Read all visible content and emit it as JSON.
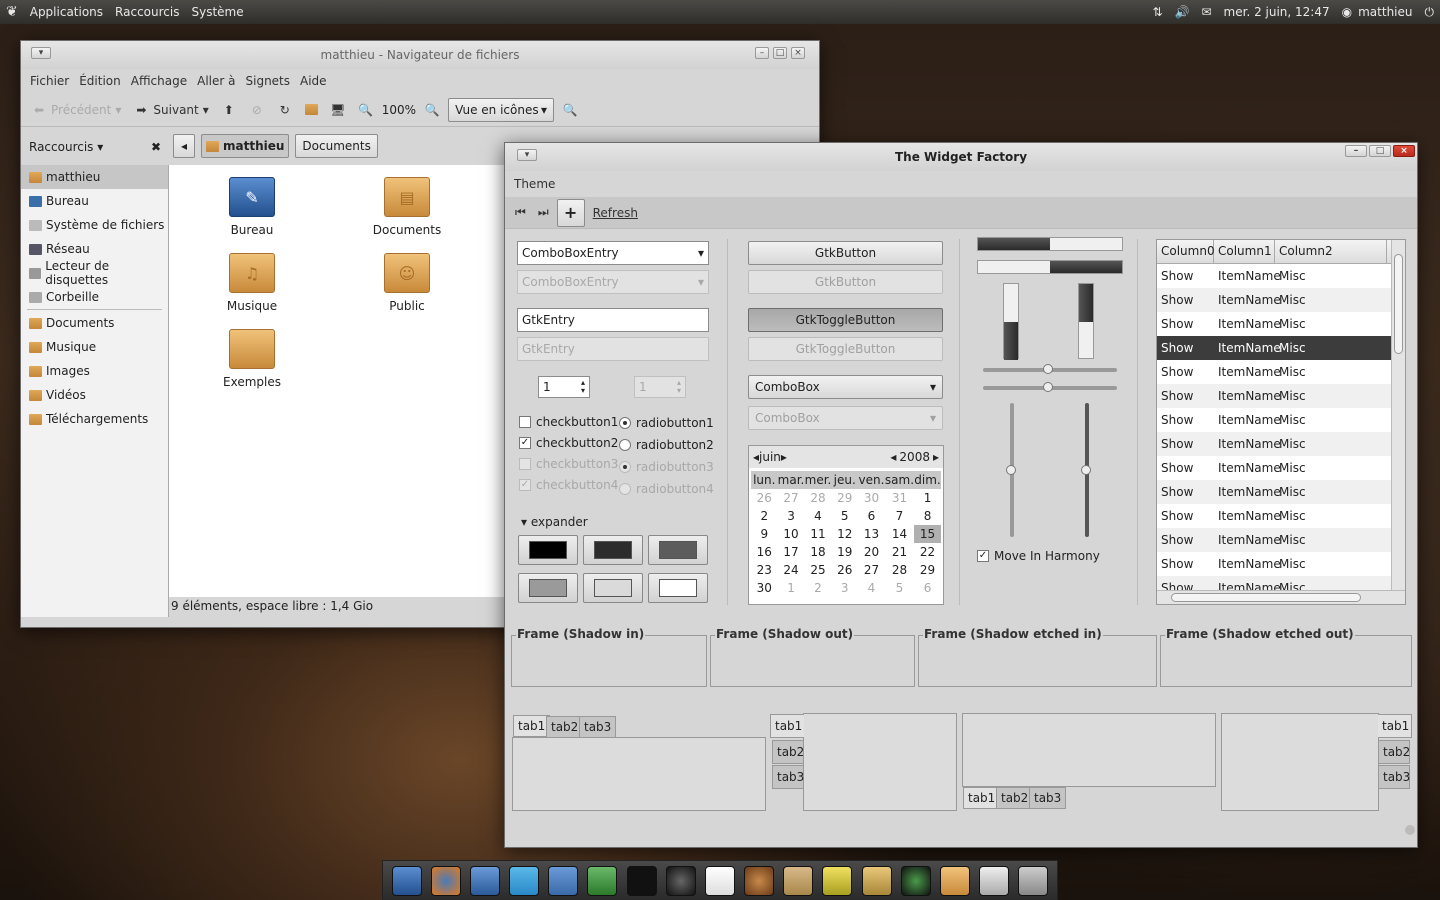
{
  "panel": {
    "menu": [
      "Applications",
      "Raccourcis",
      "Système"
    ],
    "datetime": "mer. 2 juin, 12:47",
    "user": "matthieu"
  },
  "filemanager": {
    "title": "matthieu - Navigateur de fichiers",
    "menu": [
      "Fichier",
      "Édition",
      "Affichage",
      "Aller à",
      "Signets",
      "Aide"
    ],
    "toolbar": {
      "back": "Précédent",
      "forward": "Suivant",
      "zoom": "100%",
      "view": "Vue en icônes"
    },
    "sidebar_title": "Raccourcis",
    "sidebar": [
      "matthieu",
      "Bureau",
      "Système de fichiers",
      "Réseau",
      "Lecteur de disquettes",
      "Corbeille",
      "Documents",
      "Musique",
      "Images",
      "Vidéos",
      "Téléchargements"
    ],
    "path": [
      "matthieu",
      "Documents"
    ],
    "icons": [
      "Bureau",
      "Documents",
      "Musique",
      "Public",
      "Exemples"
    ],
    "status": "9 éléments, espace libre : 1,4 Gio"
  },
  "widgetfactory": {
    "title": "The Widget Factory",
    "menu": "Theme",
    "refresh": "Refresh",
    "combo_entry": "ComboBoxEntry",
    "entry": "GtkEntry",
    "spin": "1",
    "checks": [
      "checkbutton1",
      "checkbutton2",
      "checkbutton3",
      "checkbutton4"
    ],
    "radios": [
      "radiobutton1",
      "radiobutton2",
      "radiobutton3",
      "radiobutton4"
    ],
    "expander": "expander",
    "button": "GtkButton",
    "toggle": "GtkToggleButton",
    "combo": "ComboBox",
    "calendar": {
      "month": "juin",
      "year": "2008",
      "days": [
        "lun.",
        "mar.",
        "mer.",
        "jeu.",
        "ven.",
        "sam.",
        "dim."
      ],
      "rows": [
        [
          "26",
          "27",
          "28",
          "29",
          "30",
          "31",
          "1"
        ],
        [
          "2",
          "3",
          "4",
          "5",
          "6",
          "7",
          "8"
        ],
        [
          "9",
          "10",
          "11",
          "12",
          "13",
          "14",
          "15"
        ],
        [
          "16",
          "17",
          "18",
          "19",
          "20",
          "21",
          "22"
        ],
        [
          "23",
          "24",
          "25",
          "26",
          "27",
          "28",
          "29"
        ],
        [
          "30",
          "1",
          "2",
          "3",
          "4",
          "5",
          "6"
        ]
      ]
    },
    "harmony": "Move In Harmony",
    "columns": [
      "Column0",
      "Column1",
      "Column2"
    ],
    "row": [
      "Show",
      "ItemName",
      "Misc"
    ],
    "frames": [
      "Frame (Shadow in)",
      "Frame (Shadow out)",
      "Frame (Shadow etched in)",
      "Frame (Shadow etched out)"
    ],
    "tabs": [
      "tab1",
      "tab2",
      "tab3"
    ]
  }
}
